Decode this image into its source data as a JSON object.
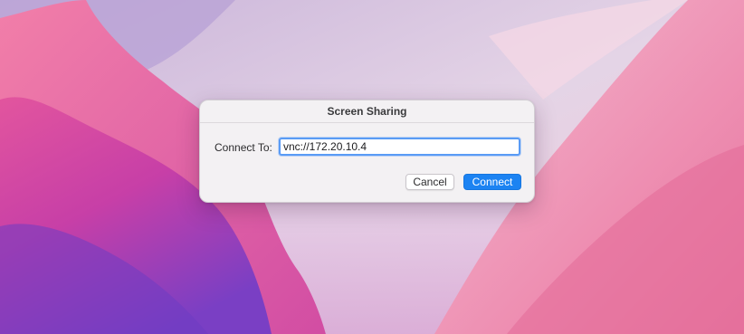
{
  "dialog": {
    "title": "Screen Sharing",
    "connect_label": "Connect To:",
    "address_value": "vnc://172.20.10.4",
    "cancel_label": "Cancel",
    "connect_label_button": "Connect"
  },
  "colors": {
    "accent": "#1c83f2",
    "focus_ring": "#5a9bf5",
    "dialog_bg": "#f3f1f3"
  }
}
